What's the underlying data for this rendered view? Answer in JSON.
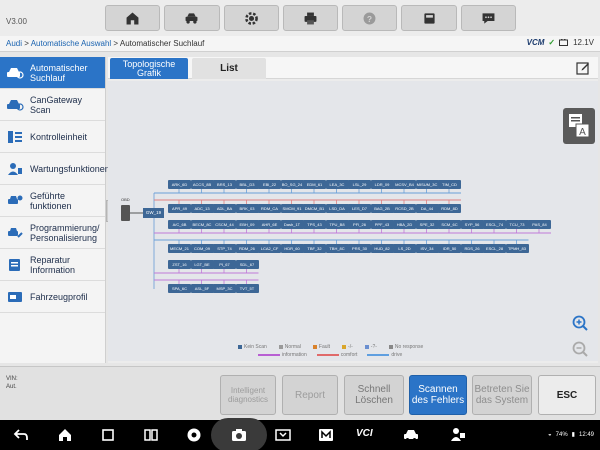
{
  "app": {
    "version": "V3.00"
  },
  "toolbar": {
    "buttons": [
      {
        "name": "home-icon"
      },
      {
        "name": "vehicle-swap-icon"
      },
      {
        "name": "settings-gear-icon"
      },
      {
        "name": "print-icon"
      },
      {
        "name": "help-icon"
      },
      {
        "name": "save-icon"
      },
      {
        "name": "chat-icon"
      }
    ]
  },
  "breadcrumb": {
    "parts": [
      "Audi",
      "Automatische Auswahl",
      "Automatischer Suchlauf"
    ],
    "sep": " > "
  },
  "status": {
    "vcm": "VCM",
    "battery_voltage": "12.1V"
  },
  "sidebar": {
    "items": [
      {
        "label": "Automatischer Suchlauf",
        "icon": "car-scan-icon",
        "active": true
      },
      {
        "label": "CanGateway Scan",
        "icon": "car-scan-icon"
      },
      {
        "label": "Kontrolleinheit",
        "icon": "module-list-icon"
      },
      {
        "label": "Wartungsfunktionen",
        "icon": "maintenance-icon"
      },
      {
        "label": "Geführte funktionen",
        "icon": "guided-function-icon"
      },
      {
        "label": "Programmierung/ Personalisierung",
        "icon": "programming-icon"
      },
      {
        "label": "Reparatur Information",
        "icon": "repair-info-icon"
      },
      {
        "label": "Fahrzeugprofil",
        "icon": "vehicle-profile-icon"
      }
    ]
  },
  "tabs": {
    "topology": "Topologische Grafik",
    "list": "List"
  },
  "topology": {
    "gateway": "GW_19",
    "rows": [
      [
        "ARK_6D",
        "ACCS_8B",
        "BRS_13",
        "BBL_D3",
        "EBI_22",
        "BO_SG_24",
        "EDM_61",
        "LEA_3C",
        "LSL_29",
        "LDR_09",
        "MCSV_B4",
        "MISUM_3C",
        "TIM_CD"
      ],
      [
        "APR_49",
        "ADC_13",
        "ADL_BA",
        "BRK_03",
        "RDM_CA",
        "SMCM_91",
        "DMCM_B1",
        "LSD_DA",
        "LES_D7",
        "BAG_2B",
        "RCSD_2B",
        "DA_44",
        "RDM_8D"
      ],
      [
        "A/C_6B",
        "BECM_8C",
        "CSCM_44",
        "EBH_09",
        "AHR_6E",
        "Dash_1T",
        "TPS_43",
        "TPU_B8",
        "PFI_26",
        "PPF_43",
        "HBA_2D",
        "SPE_32",
        "SCM_6C",
        "SYP_56",
        "ESCL_74",
        "TCU_73",
        "PAS_84"
      ],
      [
        "MECM_21",
        "COM_09",
        "STP_74",
        "RDM_26",
        "LCA2_CF",
        "HDR_60",
        "TBF_32",
        "TBH_8C",
        "PRS_30",
        "HUD_82",
        "LS_2D",
        "ISV_34",
        "IDR_50",
        "RDS_26",
        "ESCL_28",
        "TPMH_83"
      ],
      [
        "ZST_16",
        "LGT_BE",
        "PI_67",
        "SDL_67"
      ],
      [
        "SPA_6C",
        "ASL_5F",
        "MSP_3C",
        "TVT_5T"
      ]
    ]
  },
  "legend": {
    "status": [
      {
        "label": "Kein Scan",
        "color": "#3d6796"
      },
      {
        "label": "Normal",
        "color": "#9a9a9a"
      },
      {
        "label": "Fault",
        "color": "#d9822b"
      },
      {
        "label": "-/-",
        "color": "#d9a62b"
      },
      {
        "label": "-?-",
        "color": "#6a8fd0"
      },
      {
        "label": "No response",
        "color": "#888888"
      }
    ],
    "lines": [
      {
        "label": "information",
        "color": "#b85fd3"
      },
      {
        "label": "comfort",
        "color": "#e06a6a"
      },
      {
        "label": "drive",
        "color": "#5f9fe0"
      }
    ]
  },
  "vin": {
    "label": "VIN:",
    "value": "Aut."
  },
  "actions": {
    "intelligent": "Intelligent diagnostics",
    "report": "Report",
    "schnell": "Schnell Löschen",
    "scannen": "Scannen des Fehlers",
    "betreten": "Betreten Sie das System",
    "esc": "ESC"
  },
  "system": {
    "battery": "74%",
    "time": "12:49",
    "vci": "VCI"
  }
}
